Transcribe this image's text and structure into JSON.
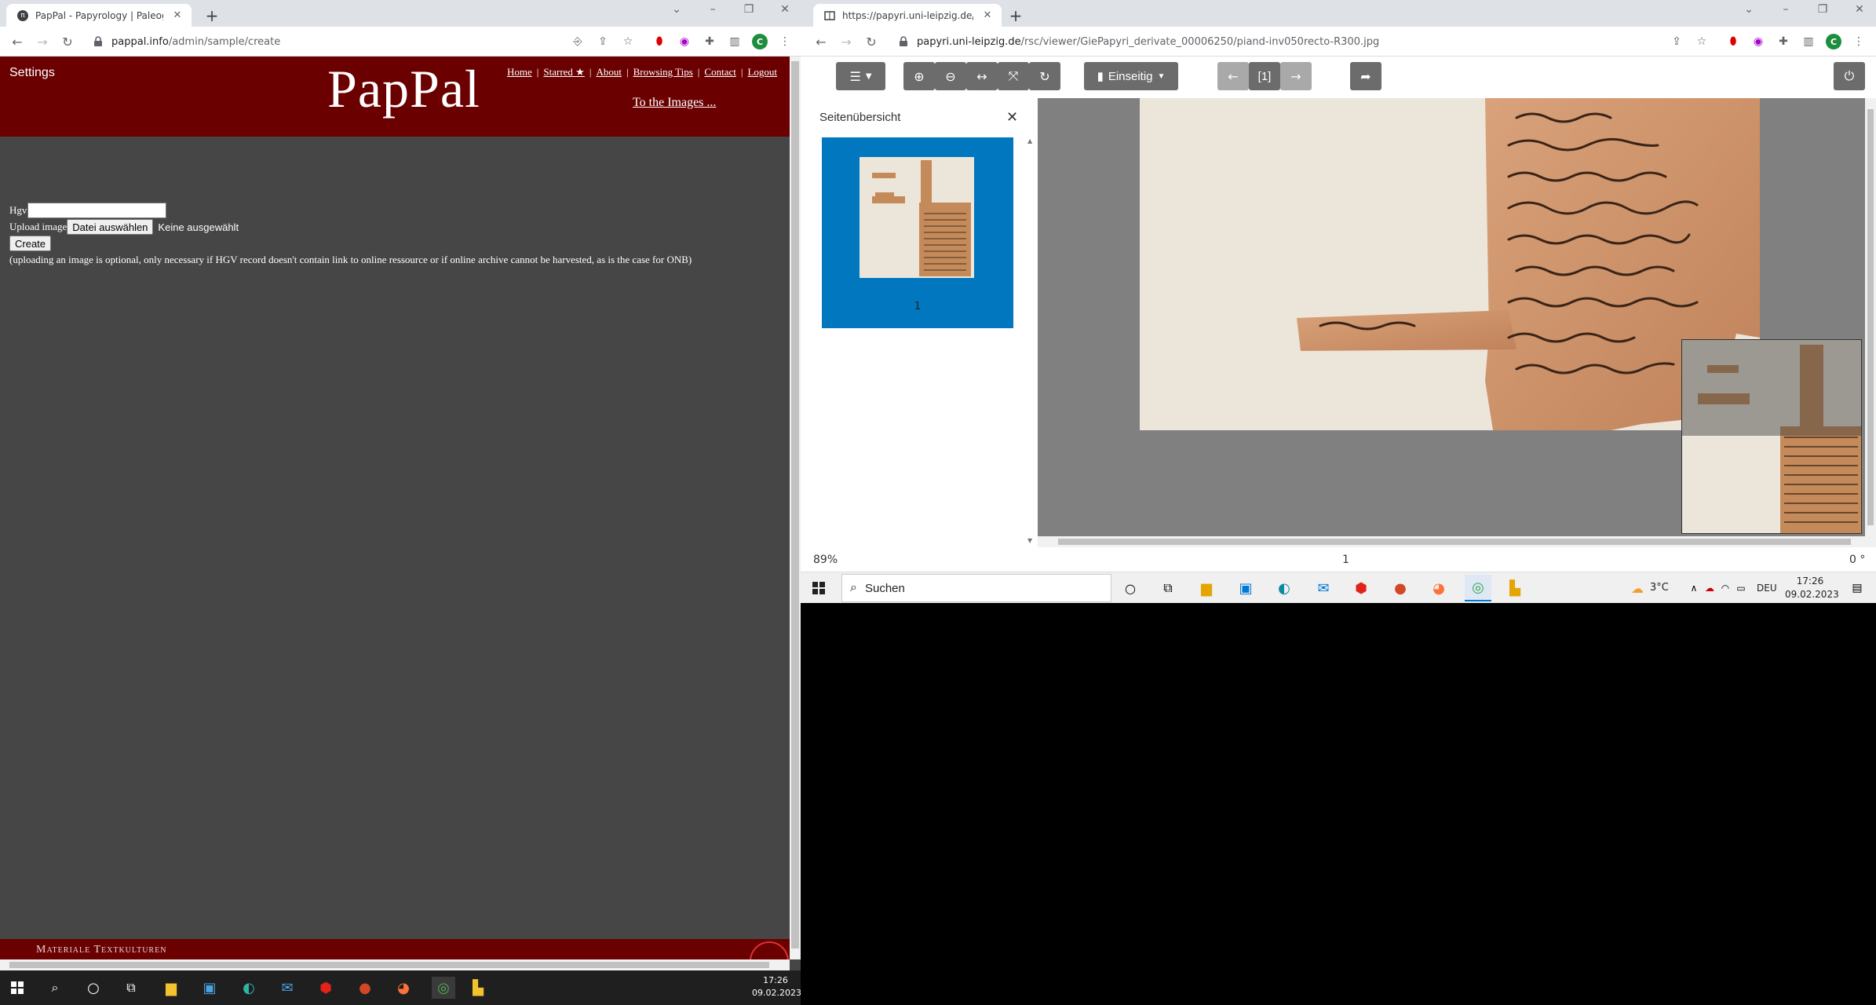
{
  "left_browser": {
    "tab_title": "PapPal - Papyrology | Paleograph",
    "tab_favicon": "π",
    "url_host": "pappal.info",
    "url_path": "/admin/sample/create",
    "profile_initial": "C"
  },
  "pappal": {
    "settings_label": "Settings",
    "logo_text": "PapPal",
    "nav": [
      "Home",
      "Starred ★",
      "About",
      "Browsing Tips",
      "Contact",
      "Logout"
    ],
    "to_images_link": "To the Images ...",
    "form": {
      "hgv_label": "Hgv",
      "hgv_value": "",
      "upload_label": "Upload image",
      "file_button": "Datei auswählen",
      "file_status": "Keine ausgewählt",
      "create_button": "Create",
      "note": "(uploading an image is optional, only necessary if HGV record doesn't contain link to online ressource or if online archive cannot be harvested, as is the case for ONB)"
    },
    "footer_text": "Materiale Textkulturen"
  },
  "right_browser": {
    "tab_title": "https://papyri.uni-leipzig.de/rsc/",
    "url_host": "papyri.uni-leipzig.de",
    "url_path": "/rsc/viewer/GiePapyri_derivate_00006250/piand-inv050recto-R300.jpg",
    "profile_initial": "C"
  },
  "viewer": {
    "page_mode_label": "Einseitig",
    "page_indicator": "[1]",
    "sidebar_title": "Seitenübersicht",
    "thumbnail_number": "1",
    "zoom_level": "89%",
    "current_page": "1",
    "rotation": "0 °"
  },
  "taskbar_right": {
    "search_placeholder": "Suchen",
    "weather": "3°C",
    "language": "DEU",
    "time": "17:26",
    "date": "09.02.2023"
  },
  "taskbar_left": {
    "time": "17:26",
    "date": "09.02.2023"
  },
  "colors": {
    "banner": "#6b0000",
    "page_bg": "#464646",
    "thumb_active": "#0077be",
    "viewer_btn": "#6c6c6c"
  }
}
